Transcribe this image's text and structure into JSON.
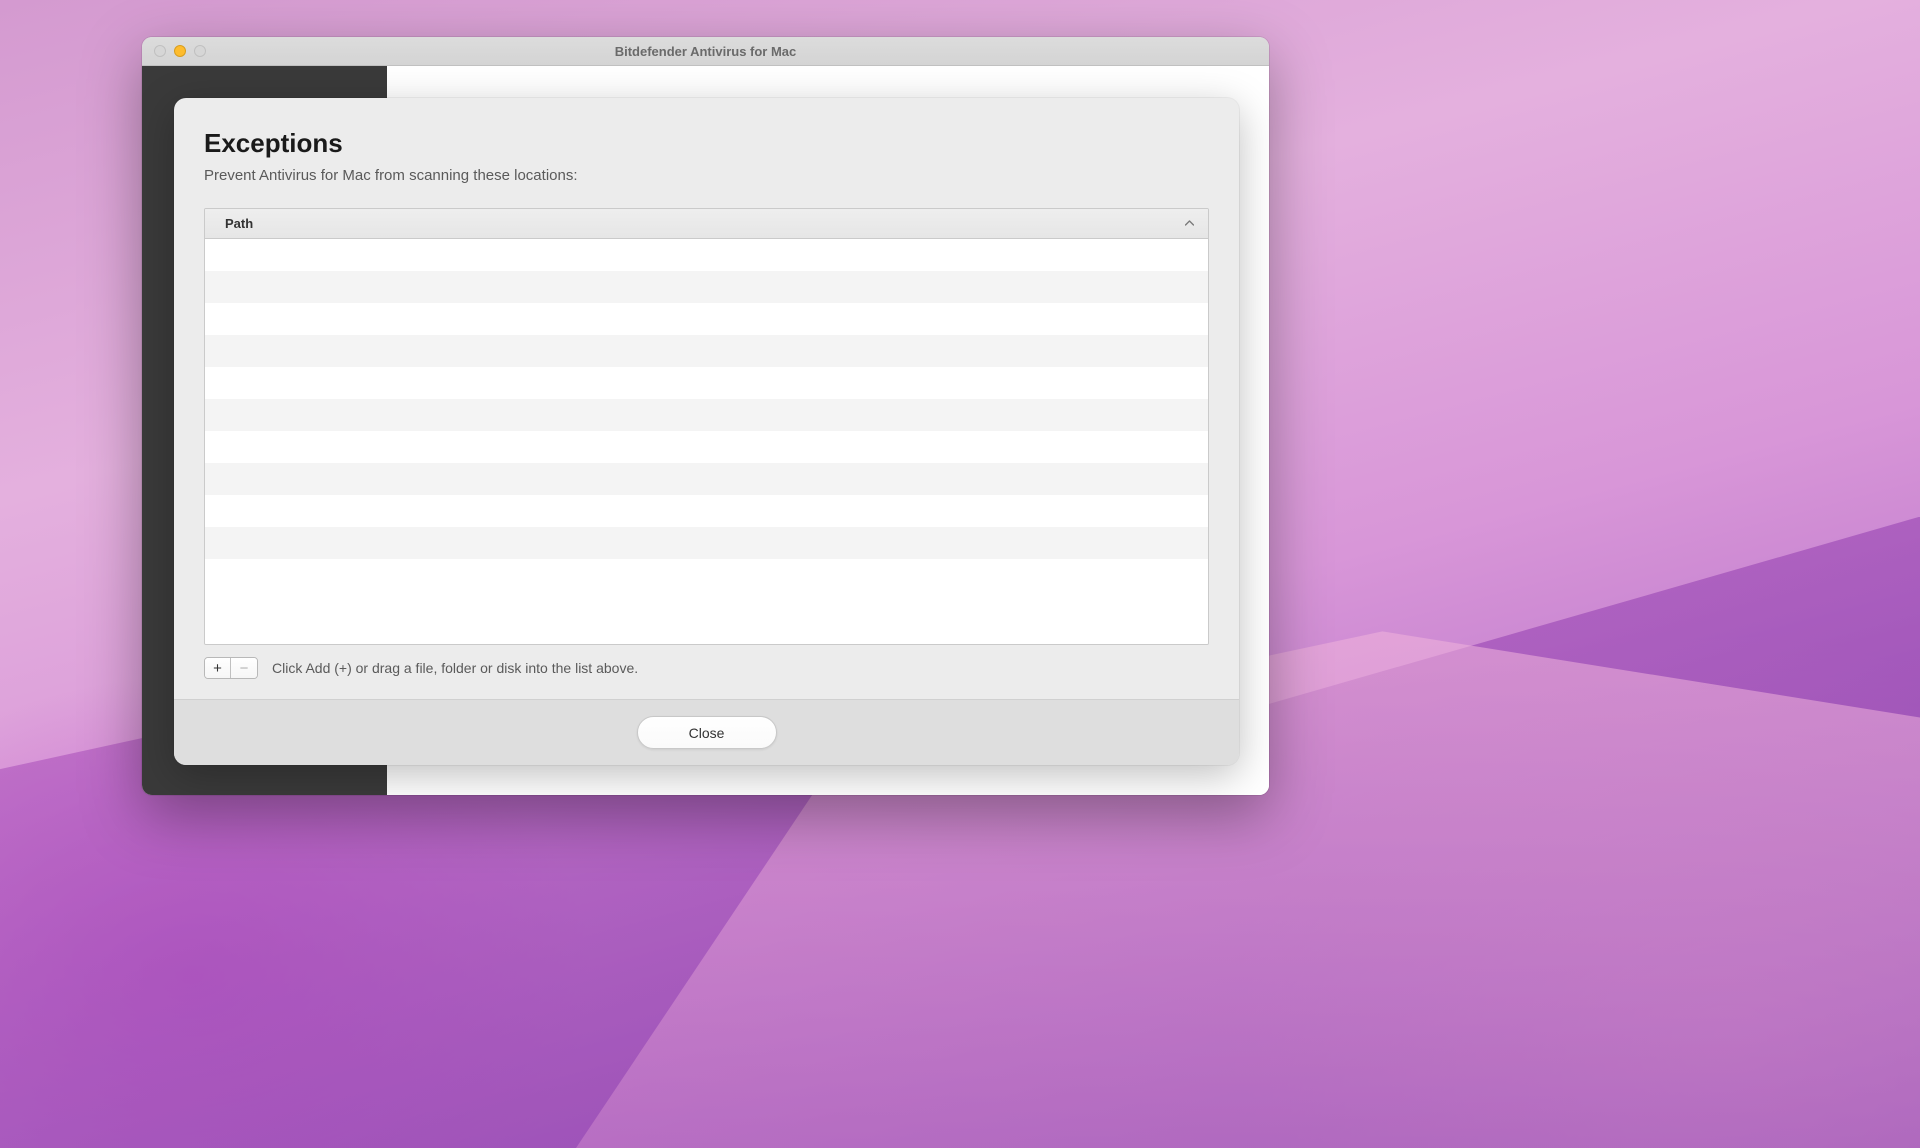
{
  "window": {
    "title": "Bitdefender Antivirus for Mac"
  },
  "modal": {
    "title": "Exceptions",
    "subtitle": "Prevent Antivirus for Mac from scanning these locations:",
    "table": {
      "header_label": "Path",
      "rows": []
    },
    "controls": {
      "add_label": "+",
      "remove_label": "−",
      "hint": "Click Add (+) or drag a file, folder or disk into the list above."
    },
    "footer": {
      "close_label": "Close"
    }
  }
}
